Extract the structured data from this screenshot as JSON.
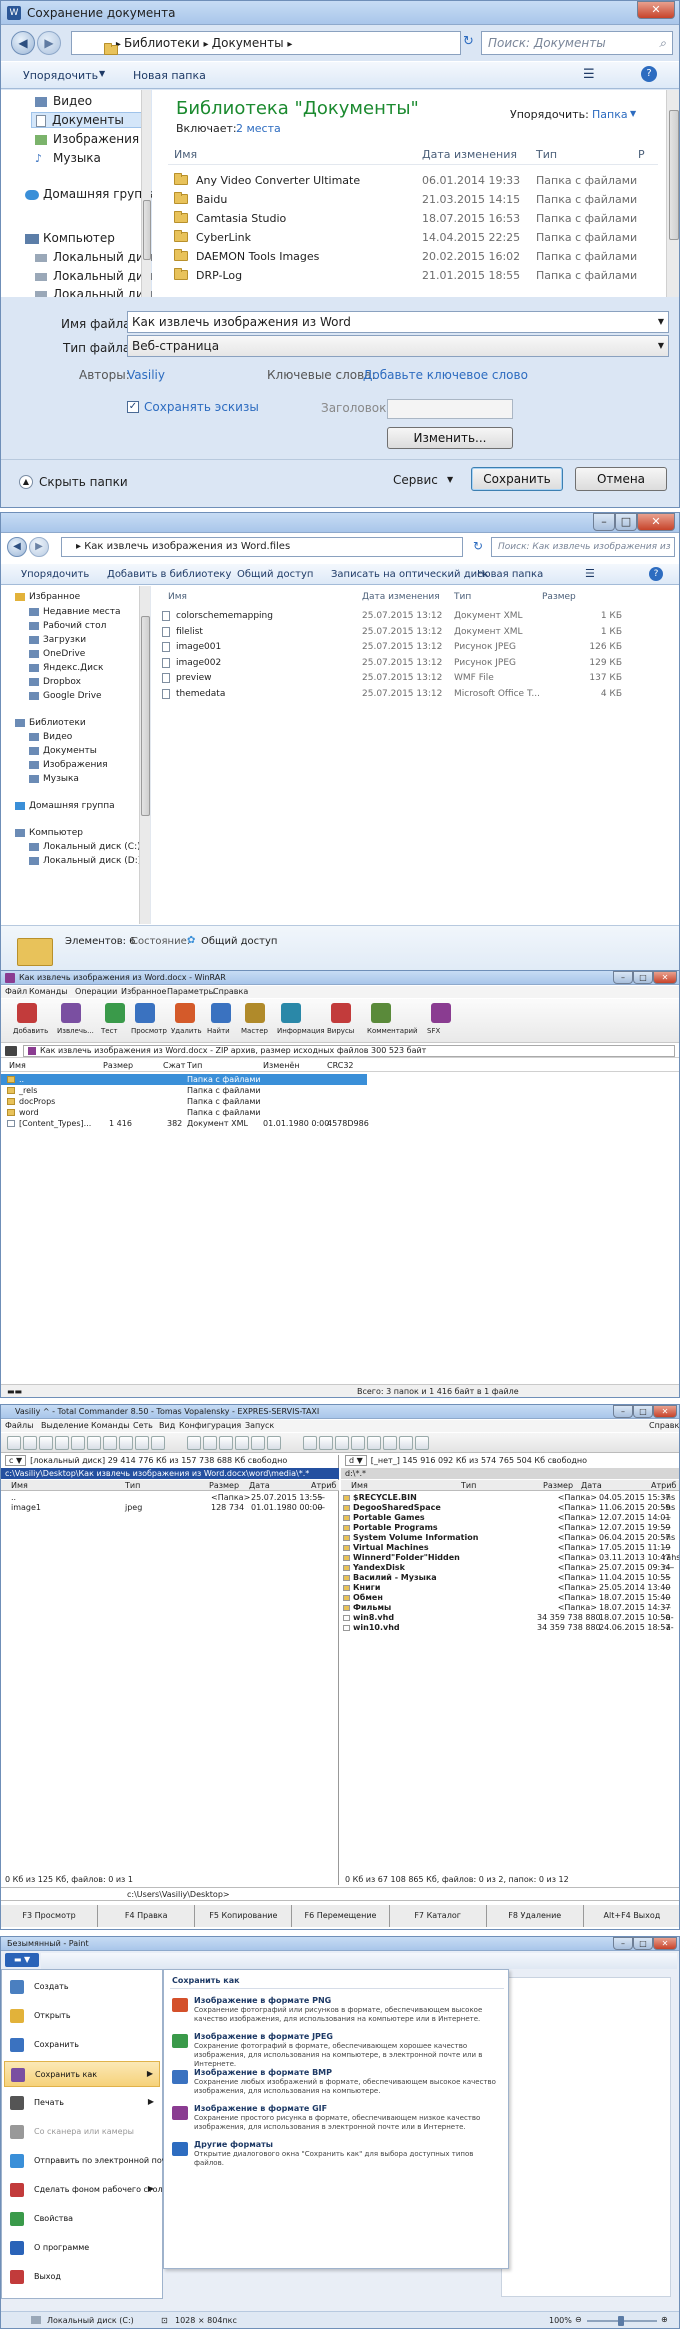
{
  "save_dialog": {
    "title": "Сохранение документа",
    "breadcrumb": [
      "Библиотеки",
      "Документы"
    ],
    "search_placeholder": "Поиск: Документы",
    "toolbar": {
      "organize": "Упорядочить",
      "new_folder": "Новая папка"
    },
    "nav": [
      "Видео",
      "Документы",
      "Изображения",
      "Музыка",
      "Домашняя группа",
      "Компьютер",
      "Локальный диск",
      "Локальный диск",
      "Локальный диск"
    ],
    "library_title": "Библиотека \"Документы\"",
    "includes_label": "Включает:",
    "includes_value": "2 места",
    "arrange_label": "Упорядочить:",
    "arrange_value": "Папка",
    "columns": [
      "Имя",
      "Дата изменения",
      "Тип",
      "Р"
    ],
    "files": [
      {
        "name": "Any Video Converter Ultimate",
        "date": "06.01.2014 19:33",
        "type": "Папка с файлами"
      },
      {
        "name": "Baidu",
        "date": "21.03.2015 14:15",
        "type": "Папка с файлами"
      },
      {
        "name": "Camtasia Studio",
        "date": "18.07.2015 16:53",
        "type": "Папка с файлами"
      },
      {
        "name": "CyberLink",
        "date": "14.04.2015 22:25",
        "type": "Папка с файлами"
      },
      {
        "name": "DAEMON Tools Images",
        "date": "20.02.2015 16:02",
        "type": "Папка с файлами"
      },
      {
        "name": "DRP-Log",
        "date": "21.01.2015 18:55",
        "type": "Папка с файлами"
      }
    ],
    "filename_label": "Имя файла:",
    "filename_value": "Как извлечь изображения из Word",
    "filetype_label": "Тип файла:",
    "filetype_value": "Веб-страница",
    "authors_label": "Авторы:",
    "authors_value": "Vasiliy",
    "keywords_label": "Ключевые слова:",
    "keywords_value": "Добавьте ключевое слово",
    "thumbs_label": "Сохранять эскизы",
    "header_label": "Заголовок:",
    "change_btn": "Изменить...",
    "hide_folders": "Скрыть папки",
    "service": "Сервис",
    "save_btn": "Сохранить",
    "cancel_btn": "Отмена"
  },
  "explorer": {
    "breadcrumb": "Как извлечь изображения из Word.files",
    "search_placeholder": "Поиск: Как извлечь изображения из Word.files",
    "toolbar": [
      "Упорядочить",
      "Добавить в библиотеку",
      "Общий доступ",
      "Записать на оптический диск",
      "Новая папка"
    ],
    "nav": [
      "Избранное",
      "Недавние места",
      "Рабочий стол",
      "Загрузки",
      "OneDrive",
      "Яндекс.Диск",
      "Dropbox",
      "Google Drive",
      "Библиотеки",
      "Видео",
      "Документы",
      "Изображения",
      "Музыка",
      "Домашняя группа",
      "Компьютер",
      "Локальный диск (C:)",
      "Локальный диск (D:)"
    ],
    "columns": [
      "Имя",
      "Дата изменения",
      "Тип",
      "Размер"
    ],
    "files": [
      {
        "name": "colorschememapping",
        "date": "25.07.2015 13:12",
        "type": "Документ XML",
        "size": "1 КБ"
      },
      {
        "name": "filelist",
        "date": "25.07.2015 13:12",
        "type": "Документ XML",
        "size": "1 КБ"
      },
      {
        "name": "image001",
        "date": "25.07.2015 13:12",
        "type": "Рисунок JPEG",
        "size": "126 КБ"
      },
      {
        "name": "image002",
        "date": "25.07.2015 13:12",
        "type": "Рисунок JPEG",
        "size": "129 КБ"
      },
      {
        "name": "preview",
        "date": "25.07.2015 13:12",
        "type": "WMF File",
        "size": "137 КБ"
      },
      {
        "name": "themedata",
        "date": "25.07.2015 13:12",
        "type": "Microsoft Office T...",
        "size": "4 КБ"
      }
    ],
    "status_count": "Элементов: 6",
    "status_label": "Состояние:",
    "status_value": "Общий доступ"
  },
  "winrar": {
    "title": "Как извлечь изображения из Word.docx - WinRAR",
    "menu": [
      "Файл",
      "Команды",
      "Операции",
      "Избранное",
      "Параметры",
      "Справка"
    ],
    "tools": [
      "Добавить",
      "Извлечь...",
      "Тест",
      "Просмотр",
      "Удалить",
      "Найти",
      "Мастер",
      "Информация",
      "Вирусы",
      "Комментарий",
      "SFX"
    ],
    "path": "Как извлечь изображения из Word.docx - ZIP архив, размер исходных файлов 300 523 байт",
    "columns": [
      "Имя",
      "Размер",
      "Сжат",
      "Тип",
      "Изменён",
      "CRC32"
    ],
    "files": [
      {
        "name": "..",
        "size": "",
        "packed": "",
        "type": "Папка с файлами",
        "modified": "",
        "crc": ""
      },
      {
        "name": "_rels",
        "size": "",
        "packed": "",
        "type": "Папка с файлами",
        "modified": "",
        "crc": ""
      },
      {
        "name": "docProps",
        "size": "",
        "packed": "",
        "type": "Папка с файлами",
        "modified": "",
        "crc": ""
      },
      {
        "name": "word",
        "size": "",
        "packed": "",
        "type": "Папка с файлами",
        "modified": "",
        "crc": ""
      },
      {
        "name": "[Content_Types]...",
        "size": "1 416",
        "packed": "382",
        "type": "Документ XML",
        "modified": "01.01.1980 0:00",
        "crc": "4578D986"
      }
    ],
    "status": "Всего: 3 папок и 1 416 байт в 1 файле"
  },
  "tc": {
    "title": "Vasiliy ^ - Total Commander 8.50 - Tomas Vopalensky - EXPRES-SERVIS-TAXI",
    "menu": [
      "Файлы",
      "Выделение",
      "Команды",
      "Сеть",
      "Вид",
      "Конфигурация",
      "Запуск"
    ],
    "help": "Справка",
    "left_drive": "[локальный диск]  29 414 776 Кб из 157 738 688 Кб свободно",
    "left_path": "c:\\Vasiliy\\Desktop\\Как извлечь изображения из Word.docx\\word\\media\\*.*",
    "right_drive": "[_нет_]  145 916 092 Кб из 574 765 504 Кб свободно",
    "right_path": "d:\\*.*",
    "columns": [
      "Имя",
      "Тип",
      "Размер",
      "Дата",
      "Атриб"
    ],
    "left_files": [
      {
        "name": "..",
        "type": "",
        "size": "<Папка>",
        "date": "25.07.2015 13:55",
        "attr": "—"
      },
      {
        "name": "image1",
        "type": "jpeg",
        "size": "128 734",
        "date": "01.01.1980 00:00",
        "attr": "—"
      }
    ],
    "right_files": [
      {
        "name": "$RECYCLE.BIN",
        "size": "<Папка>",
        "date": "04.05.2015 15:37",
        "attr": "-hs"
      },
      {
        "name": "DegooSharedSpace",
        "size": "<Папка>",
        "date": "11.06.2015 20:59",
        "attr": "-hs"
      },
      {
        "name": "Portable Games",
        "size": "<Папка>",
        "date": "12.07.2015 14:01",
        "attr": "—"
      },
      {
        "name": "Portable Programs",
        "size": "<Папка>",
        "date": "12.07.2015 19:59",
        "attr": "—"
      },
      {
        "name": "System Volume Information",
        "size": "<Папка>",
        "date": "06.04.2015 20:57",
        "attr": "-hs"
      },
      {
        "name": "Virtual Machines",
        "size": "<Папка>",
        "date": "17.05.2015 11:19",
        "attr": "—"
      },
      {
        "name": "Winnerd\"Folder\"Hidden",
        "size": "<Папка>",
        "date": "03.11.2013 10:47",
        "attr": "rahs"
      },
      {
        "name": "YandexDisk",
        "size": "<Папка>",
        "date": "25.07.2015 09:34",
        "attr": "r—"
      },
      {
        "name": "Василий - Музыка",
        "size": "<Папка>",
        "date": "11.04.2015 10:55",
        "attr": "—"
      },
      {
        "name": "Книги",
        "size": "<Папка>",
        "date": "25.05.2014 13:40",
        "attr": "—"
      },
      {
        "name": "Обмен",
        "size": "<Папка>",
        "date": "18.07.2015 15:40",
        "attr": "—"
      },
      {
        "name": "Фильмы",
        "size": "<Папка>",
        "date": "18.07.2015 14:37",
        "attr": "—"
      },
      {
        "name": "win8.vhd",
        "size": "34 359 738 880",
        "date": "18.07.2015 10:50",
        "attr": "-a-"
      },
      {
        "name": "win10.vhd",
        "size": "34 359 738 880",
        "date": "24.06.2015 18:57",
        "attr": "-a-"
      }
    ],
    "left_status": "0 Кб из 125 Кб, файлов: 0 из 1",
    "right_status": "0 Кб из 67 108 865 Кб, файлов: 0 из 2, папок: 0 из 12",
    "cmd_path": "c:\\Users\\Vasiliy\\Desktop>",
    "fkeys": [
      "F3 Просмотр",
      "F4 Правка",
      "F5 Копирование",
      "F6 Перемещение",
      "F7 Каталог",
      "F8 Удаление",
      "Alt+F4 Выход"
    ]
  },
  "paint": {
    "title": "Безымянный - Paint",
    "menu": [
      "Создать",
      "Открыть",
      "Сохранить",
      "Сохранить как",
      "Печать",
      "Со сканера или камеры",
      "Отправить по электронной почте",
      "Сделать фоном рабочего стола",
      "Свойства",
      "О программе",
      "Выход"
    ],
    "submenu_title": "Сохранить как",
    "options": [
      {
        "title": "Изображение в формате PNG",
        "desc": "Сохранение фотографий или рисунков в формате, обеспечивающем высокое качество изображения, для использования на компьютере или в Интернете."
      },
      {
        "title": "Изображение в формате JPEG",
        "desc": "Сохранение фотографий в формате, обеспечивающем хорошее качество изображения, для использования на компьютере, в электронной почте или в Интернете."
      },
      {
        "title": "Изображение в формате BMP",
        "desc": "Сохранение любых изображений в формате, обеспечивающем высокое качество изображения, для использования на компьютере."
      },
      {
        "title": "Изображение в формате GIF",
        "desc": "Сохранение простого рисунка в формате, обеспечивающем низкое качество изображения, для использования в электронной почте или в Интернете."
      },
      {
        "title": "Другие форматы",
        "desc": "Открытие диалогового окна \"Сохранить как\" для выбора доступных типов файлов."
      }
    ],
    "status_disk": "Локальный диск (C:)",
    "status_size": "1028 × 804пкс",
    "zoom": "100%"
  }
}
